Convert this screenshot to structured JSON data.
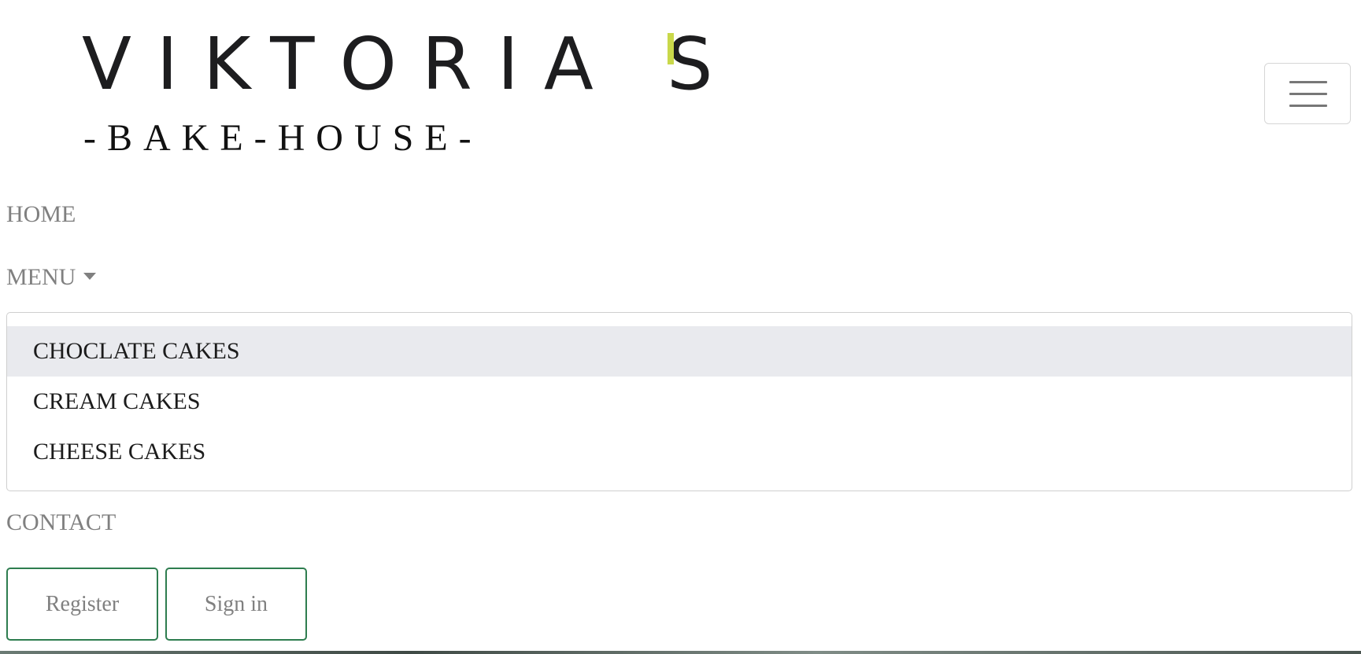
{
  "logo": {
    "name": "VIKTORIA'S",
    "main_text": "VIKTORIA S",
    "sub_text": "-BAKE-HOUSE-",
    "accent_color": "#c9d84a"
  },
  "navbar": {
    "toggler_icon": "hamburger-icon",
    "links": {
      "home": "HOME",
      "menu": "MENU",
      "contact": "CONTACT"
    }
  },
  "dropdown": {
    "items": [
      {
        "label": "CHOCLATE CAKES",
        "active": true
      },
      {
        "label": "CREAM CAKES",
        "active": false
      },
      {
        "label": "CHEESE CAKES",
        "active": false
      }
    ]
  },
  "auth": {
    "register_label": "Register",
    "signin_label": "Sign in",
    "border_color": "#2e7d4f"
  }
}
